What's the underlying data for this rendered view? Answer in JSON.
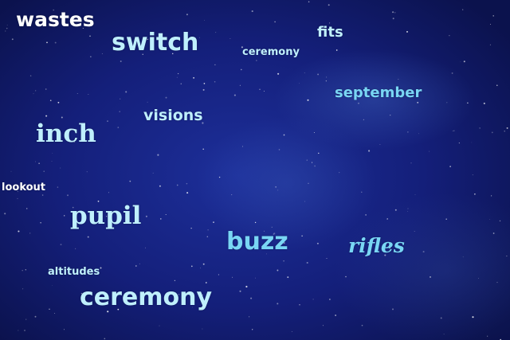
{
  "background": {
    "description_colors": {
      "sky_dark": "#0b124d",
      "sky_mid": "#141f7a",
      "sky_light": "#1d2f9a"
    }
  },
  "words": {
    "wastes": "wastes",
    "switch": "switch",
    "ceremony_small": "ceremony",
    "fits": "fits",
    "september": "september",
    "visions": "visions",
    "inch": "inch",
    "lookout": "lookout",
    "pupil": "pupil",
    "buzz": "buzz",
    "rifles": "rifles",
    "altitudes": "altitudes",
    "ceremony": "ceremony"
  },
  "colors": {
    "white_text": "#ffffff",
    "pale_cyan_text": "#bfeffd",
    "cyan_text": "#79d6f4"
  }
}
